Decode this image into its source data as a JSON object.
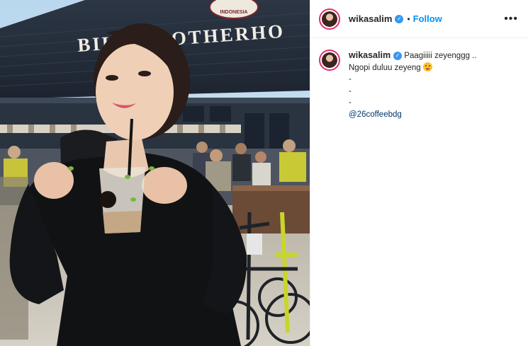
{
  "media": {
    "sign_text": "BIKE BROTHERHO",
    "badge_text": "INDONESIA"
  },
  "header": {
    "username": "wikasalim",
    "separator": "•",
    "follow_label": "Follow",
    "more_label": "•••"
  },
  "caption": {
    "username": "wikasalim",
    "line1": "Paagiiiii zeyenggg ..",
    "line2": "Ngopi duluu zeyeng",
    "dash1": "-",
    "dash2": "-",
    "dash3": "-",
    "mention": "@26coffeebdg"
  },
  "colors": {
    "accent": "#0095f6",
    "verified": "#3897f0",
    "story_ring": "#e1306c",
    "mention": "#00376b"
  },
  "icons": {
    "verified": "verified-badge-icon",
    "more": "more-options-icon",
    "emoji": "winking-tongue-emoji-icon"
  }
}
